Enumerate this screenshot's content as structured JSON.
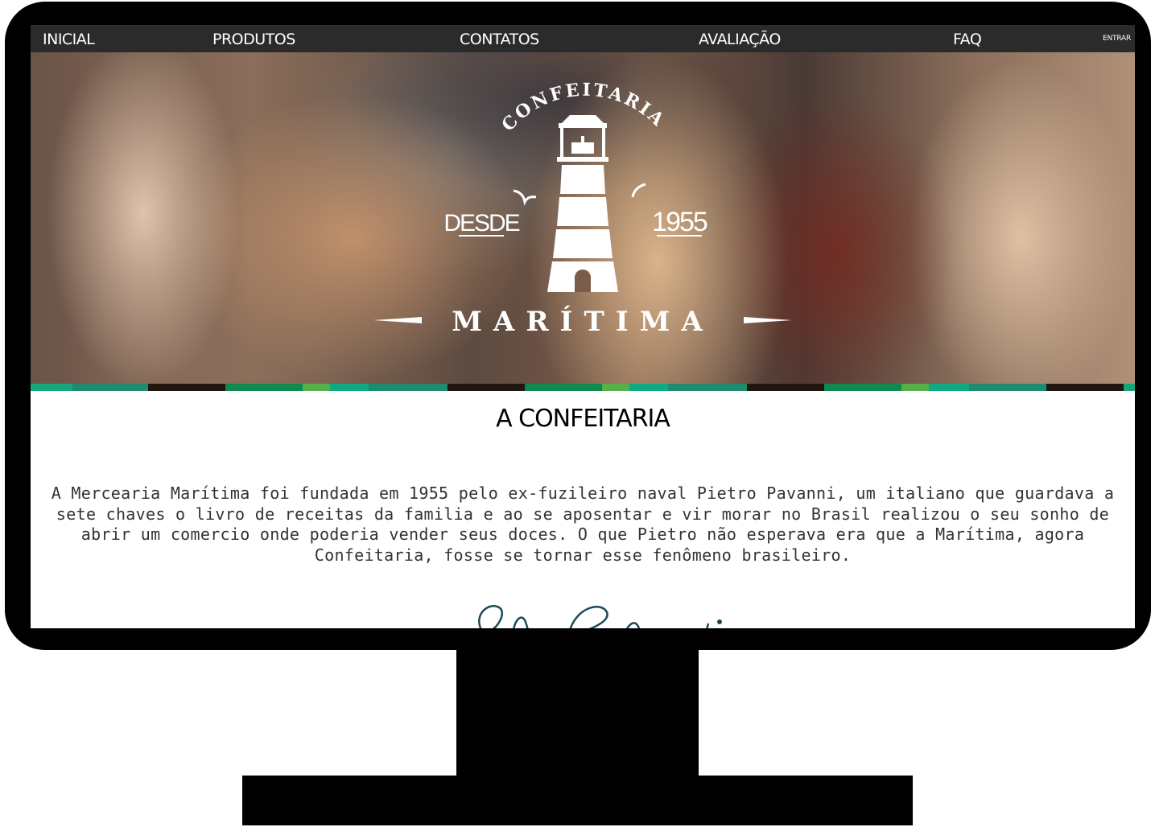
{
  "nav": {
    "items": [
      {
        "label": "INICIAL"
      },
      {
        "label": "PRODUTOS"
      },
      {
        "label": "CONTATOS"
      },
      {
        "label": "AVALIAÇÃO"
      },
      {
        "label": "FAQ"
      }
    ],
    "login_label": "ENTRAR"
  },
  "hero": {
    "logo": {
      "top_text": "CONFEITARIA",
      "left_text": "DESDE",
      "right_text": "1955",
      "name": "MARÍTIMA"
    }
  },
  "stripe_colors": [
    "#17a57a",
    "#1d8c6e",
    "#221710",
    "#0f8a4e",
    "#55b04a",
    "#11a884"
  ],
  "about": {
    "title": "A CONFEITARIA",
    "text": "A Mercearia Marítima foi fundada em 1955 pelo ex-fuzileiro naval Pietro Pavanni, um italiano que guardava a sete chaves o livro de receitas da familia e ao se aposentar e vir morar no Brasil realizou o seu sonho de abrir um comercio onde poderia vender seus doces. O que Pietro não esperava era que a Marítima, agora Confeitaria, fosse se tornar esse fenômeno brasileiro."
  },
  "colors": {
    "nav_bg": "#2b2b2b",
    "signature": "#1c4a5a"
  }
}
